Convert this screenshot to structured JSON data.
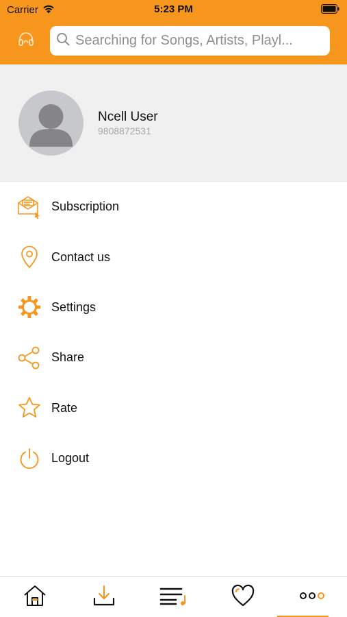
{
  "status_bar": {
    "carrier": "Carrier",
    "time": "5:23 PM"
  },
  "header": {
    "search_placeholder": "Searching for Songs, Artists, Playl...",
    "accent_color": "#f7961d"
  },
  "profile": {
    "name": "Ncell User",
    "phone": "9808872531"
  },
  "menu": [
    {
      "label": "Subscription",
      "icon": "subscription-icon"
    },
    {
      "label": "Contact us",
      "icon": "location-pin-icon"
    },
    {
      "label": "Settings",
      "icon": "gear-icon"
    },
    {
      "label": "Share",
      "icon": "share-icon"
    },
    {
      "label": "Rate",
      "icon": "star-icon"
    },
    {
      "label": "Logout",
      "icon": "power-icon"
    }
  ],
  "tabs": [
    {
      "icon": "home-icon"
    },
    {
      "icon": "download-icon"
    },
    {
      "icon": "playlist-icon"
    },
    {
      "icon": "heart-icon"
    },
    {
      "icon": "more-icon",
      "selected": true
    }
  ]
}
